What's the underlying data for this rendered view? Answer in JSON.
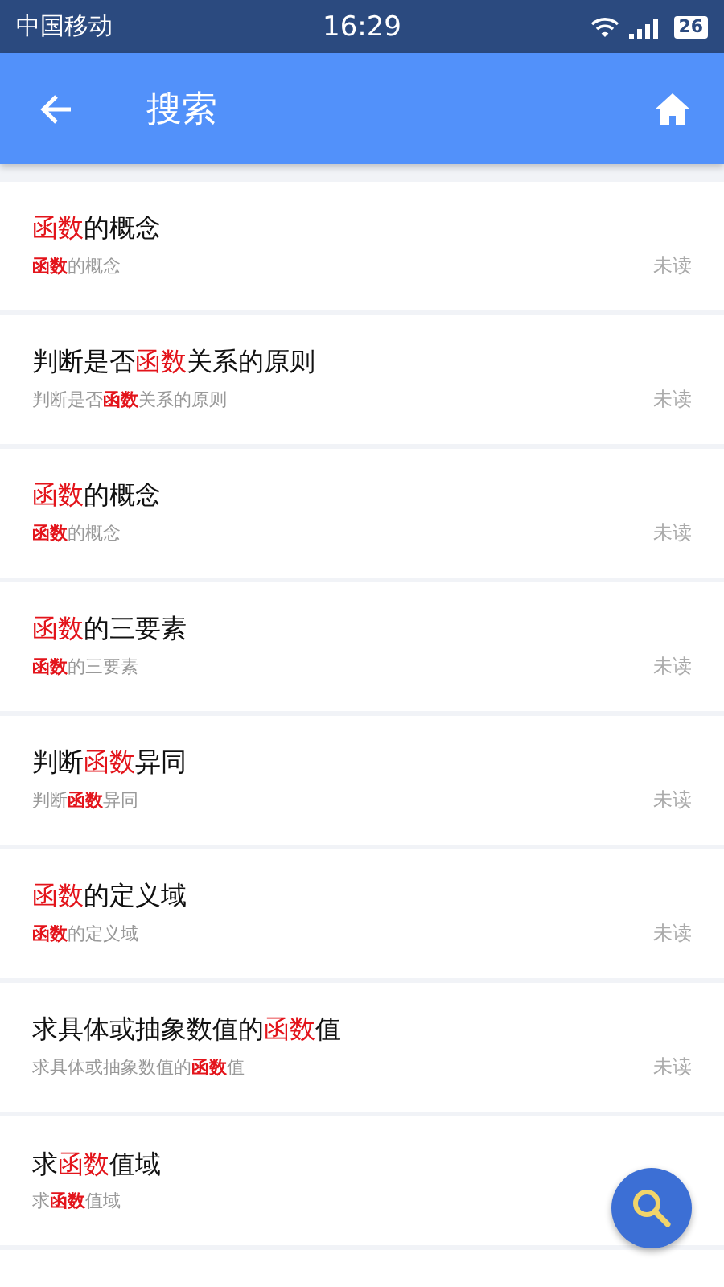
{
  "status_bar": {
    "carrier": "中国移动",
    "time": "16:29",
    "battery": "26"
  },
  "app_bar": {
    "title": "搜索"
  },
  "results": [
    {
      "title": "**函数**的概念",
      "snippet": "**函数**的概念",
      "status": "未读"
    },
    {
      "title": "判断是否**函数**关系的原则",
      "snippet": "判断是否**函数**关系的原则",
      "status": "未读"
    },
    {
      "title": "**函数**的概念",
      "snippet": "**函数**的概念",
      "status": "未读"
    },
    {
      "title": "**函数**的三要素",
      "snippet": "**函数**的三要素",
      "status": "未读"
    },
    {
      "title": "判断**函数**异同",
      "snippet": "判断**函数**异同",
      "status": "未读"
    },
    {
      "title": "**函数**的定义域",
      "snippet": "**函数**的定义域",
      "status": "未读"
    },
    {
      "title": "求具体或抽象数值的**函数**值",
      "snippet": "求具体或抽象数值的**函数**值",
      "status": "未读"
    },
    {
      "title": "求**函数**值域",
      "snippet": "求**函数**值域"
    }
  ]
}
